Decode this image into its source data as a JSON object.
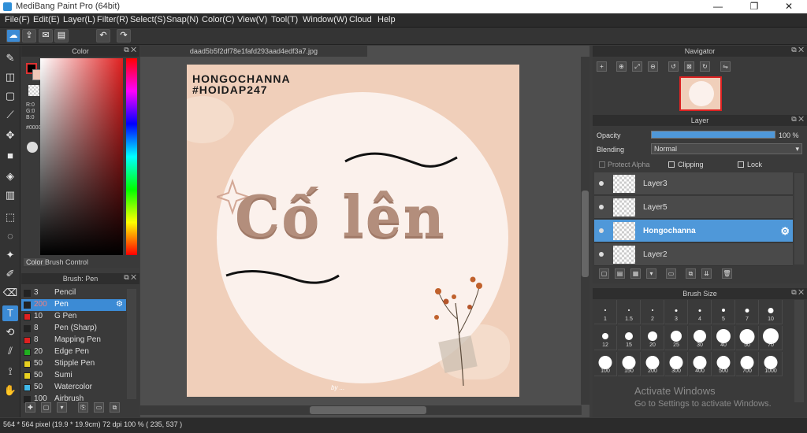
{
  "window": {
    "title": "MediBang Paint Pro (64bit)",
    "minimize": "—",
    "maximize": "❐",
    "close": "✕"
  },
  "menu": [
    "File(F)",
    "Edit(E)",
    "Layer(L)",
    "Filter(R)",
    "Select(S)",
    "Snap(N)",
    "Color(C)",
    "View(V)",
    "Tool(T)",
    "Window(W)",
    "Cloud",
    "Help"
  ],
  "color_panel": {
    "title": "Color",
    "r": "R:0",
    "g": "G:0",
    "b": "B:0",
    "hex": "#000000",
    "tab_color": "Color",
    "tab_brush": "Brush Control"
  },
  "brush_panel": {
    "title": "Brush: Pen",
    "items": [
      {
        "size": "3",
        "name": "Pencil",
        "color": "#222222"
      },
      {
        "size": "200",
        "name": "Pen",
        "color": "#222222",
        "selected": true
      },
      {
        "size": "10",
        "name": "G Pen",
        "color": "#e02020"
      },
      {
        "size": "8",
        "name": "Pen (Sharp)",
        "color": "#222222"
      },
      {
        "size": "8",
        "name": "Mapping Pen",
        "color": "#e02020"
      },
      {
        "size": "20",
        "name": "Edge Pen",
        "color": "#20b020"
      },
      {
        "size": "50",
        "name": "Stipple Pen",
        "color": "#e8d020"
      },
      {
        "size": "50",
        "name": "Sumi",
        "color": "#e8d020"
      },
      {
        "size": "50",
        "name": "Watercolor",
        "color": "#40b8e8"
      },
      {
        "size": "100",
        "name": "Airbrush",
        "color": "#222222"
      }
    ]
  },
  "document": {
    "tab": "daad5b5f2df78e1fafd293aad4edf3a7.jpg",
    "watermark_line1": "HONGOCHANNA",
    "watermark_line2": "#HOIDAP247",
    "main_text": "Cố lên",
    "signature": "by ..."
  },
  "navigator": {
    "title": "Navigator"
  },
  "layer_panel": {
    "title": "Layer",
    "opacity_label": "Opacity",
    "opacity_value": "100 %",
    "blending_label": "Blending",
    "blending_value": "Normal",
    "protect_alpha": "Protect Alpha",
    "clipping": "Clipping",
    "lock": "Lock",
    "layers": [
      {
        "name": "Layer3",
        "selected": false
      },
      {
        "name": "Layer5",
        "selected": false
      },
      {
        "name": "Hongochanna",
        "selected": true
      },
      {
        "name": "Layer2",
        "selected": false
      }
    ]
  },
  "brush_size": {
    "title": "Brush Size",
    "sizes": [
      "1",
      "1.5",
      "2",
      "3",
      "4",
      "5",
      "7",
      "10",
      "12",
      "15",
      "20",
      "25",
      "30",
      "40",
      "50",
      "70",
      "100",
      "150",
      "200",
      "300",
      "400",
      "500",
      "700",
      "1000"
    ]
  },
  "status": {
    "text": "564 * 564 pixel  (19.9 * 19.9cm)  72 dpi  100 %  ( 235, 537 )"
  },
  "activation": {
    "line1": "Activate Windows",
    "line2": "Go to Settings to activate Windows."
  },
  "colors": {
    "accent": "#3c8bd5",
    "canvas_bg": "#f0cfba",
    "circle": "#fbf1ec"
  }
}
